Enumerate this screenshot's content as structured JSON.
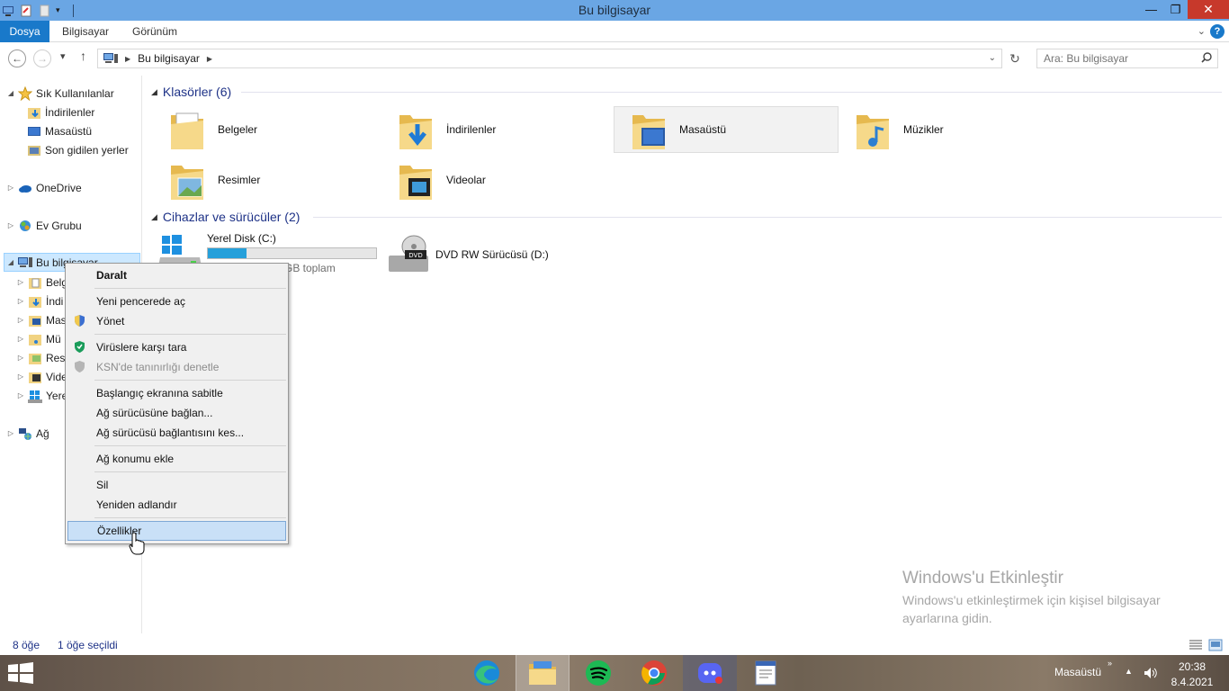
{
  "window": {
    "title": "Bu bilgisayar",
    "buttons": {
      "minimize": "—",
      "maximize": "❐",
      "close": "✕"
    }
  },
  "ribbon": {
    "tabs": [
      "Dosya",
      "Bilgisayar",
      "Görünüm"
    ],
    "help": "?"
  },
  "address": {
    "breadcrumb": "Bu bilgisayar",
    "search_placeholder": "Ara: Bu bilgisayar"
  },
  "nav": {
    "favorites": "Sık Kullanılanlar",
    "fav_items": [
      "İndirilenler",
      "Masaüstü",
      "Son gidilen yerler"
    ],
    "onedrive": "OneDrive",
    "homegroup": "Ev Grubu",
    "thispc": "Bu bilgisayar",
    "pc_children": [
      "Belg",
      "İndi",
      "Mas",
      "Mü",
      "Resi",
      "Vide",
      "Yere"
    ],
    "network": "Ağ"
  },
  "content": {
    "folders_header": "Klasörler (6)",
    "folders": [
      "Belgeler",
      "İndirilenler",
      "Masaüstü",
      "Müzikler",
      "Resimler",
      "Videolar"
    ],
    "devices_header": "Cihazlar ve sürücüler (2)",
    "drive_c": {
      "name": "Yerel Disk (C:)",
      "sub": "GB toplam",
      "used_fraction": 0.23
    },
    "drive_d": {
      "name": "DVD RW Sürücüsü (D:)",
      "badge": "DVD"
    }
  },
  "context_menu": {
    "items": [
      {
        "label": "Daralt",
        "bold": true
      },
      {
        "label": "Yeni pencerede aç"
      },
      {
        "label": "Yönet",
        "icon": "uac-shield-icon"
      },
      {
        "label": "Virüslere karşı tara",
        "icon": "kaspersky-shield-icon"
      },
      {
        "label": "KSN'de tanınırlığı denetle",
        "icon": "ksn-shield-icon",
        "disabled": true
      },
      {
        "label": "Başlangıç ekranına sabitle"
      },
      {
        "label": "Ağ sürücüsüne bağlan..."
      },
      {
        "label": "Ağ sürücüsü bağlantısını kes..."
      },
      {
        "label": "Ağ konumu ekle"
      },
      {
        "label": "Sil"
      },
      {
        "label": "Yeniden adlandır"
      },
      {
        "label": "Özellikler",
        "highlighted": true
      }
    ]
  },
  "status": {
    "count": "8 öğe",
    "selected": "1 öğe seçildi"
  },
  "watermark": {
    "title": "Windows'u Etkinleştir",
    "body": "Windows'u etkinleştirmek için kişisel bilgisayar ayarlarına gidin."
  },
  "taskbar": {
    "apps": [
      "edge-icon",
      "file-explorer-icon",
      "spotify-icon",
      "chrome-icon",
      "discord-icon",
      "notepad-icon"
    ],
    "desktop_label": "Masaüstü",
    "time": "20:38",
    "date": "8.4.2021"
  },
  "colors": {
    "titlebar": "#6aa6e4",
    "file_tab": "#1979ca",
    "group_header": "#1e3287",
    "drive_bar": "#26a0da",
    "menu_highlight": "#c9e0f7"
  }
}
